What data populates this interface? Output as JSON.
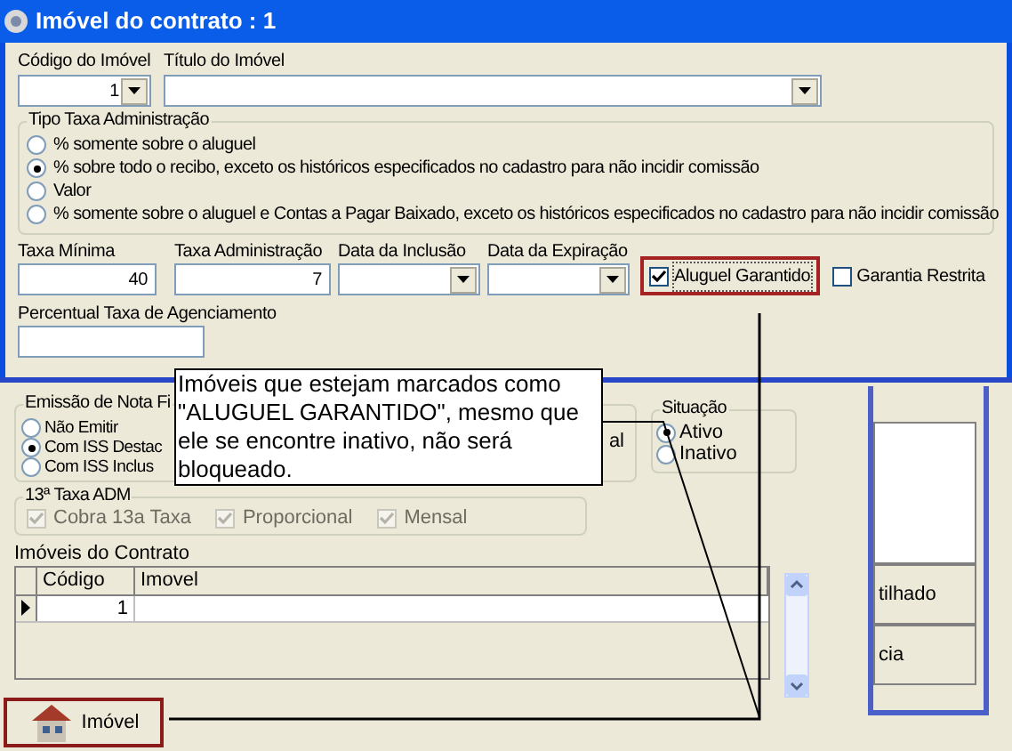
{
  "dialog": {
    "title": "Imóvel do contrato : 1",
    "codigo": {
      "label": "Código do Imóvel",
      "value": "1"
    },
    "titulo": {
      "label": "Título do Imóvel"
    },
    "tipo_taxa": {
      "label": "Tipo Taxa Administração",
      "options": [
        {
          "label": "% somente sobre o aluguel",
          "selected": false
        },
        {
          "label": "% sobre todo o recibo, exceto os históricos especificados no cadastro para não incidir comissão",
          "selected": true
        },
        {
          "label": "Valor",
          "selected": false
        },
        {
          "label": "% somente sobre o aluguel e Contas a Pagar Baixado, exceto os históricos especificados no cadastro para não incidir comissão",
          "selected": false
        }
      ]
    },
    "fields": [
      {
        "kind": "text",
        "label": "Taxa Mínima",
        "value": "40"
      },
      {
        "kind": "text",
        "label": "Taxa Administração",
        "value": "7"
      },
      {
        "kind": "combo",
        "label": "Data da Inclusão"
      },
      {
        "kind": "combo",
        "label": "Data da Expiração"
      }
    ],
    "checks": [
      {
        "label": "Aluguel Garantido",
        "checked": true,
        "highlighted": true
      },
      {
        "label": "Garantia Restrita",
        "checked": false,
        "highlighted": false
      }
    ],
    "percentual": {
      "label": "Percentual Taxa de Agenciamento"
    }
  },
  "background": {
    "emissao": {
      "label": "Emissão de Nota Fi",
      "fragment": "al",
      "options": [
        {
          "label": "Não Emitir",
          "selected": false
        },
        {
          "label": "Com ISS Destac",
          "selected": true
        },
        {
          "label": "Com ISS Inclus",
          "selected": false
        }
      ]
    },
    "situacao": {
      "label": "Situação",
      "options": [
        {
          "label": "Ativo",
          "selected": true
        },
        {
          "label": "Inativo",
          "selected": false
        }
      ]
    },
    "taxa13": {
      "label": "13ª Taxa ADM",
      "options": [
        {
          "label": "Cobra 13a Taxa",
          "checked": true,
          "disabled": true
        },
        {
          "label": "Proporcional",
          "checked": true,
          "disabled": true
        },
        {
          "label": "Mensal",
          "checked": true,
          "disabled": true
        }
      ]
    },
    "grid": {
      "label": "Imóveis do Contrato",
      "columns": [
        "Código",
        "Imovel"
      ],
      "rows": [
        {
          "codigo": "1",
          "current": true
        }
      ]
    },
    "side_buttons": [
      "tilhado",
      "cia"
    ],
    "imovel_button": {
      "label": "Imóvel",
      "highlighted": true
    }
  },
  "callout": {
    "text": "Imóveis que estejam marcados como \"ALUGUEL GARANTIDO\", mesmo que ele se encontre inativo, não será bloqueado."
  }
}
